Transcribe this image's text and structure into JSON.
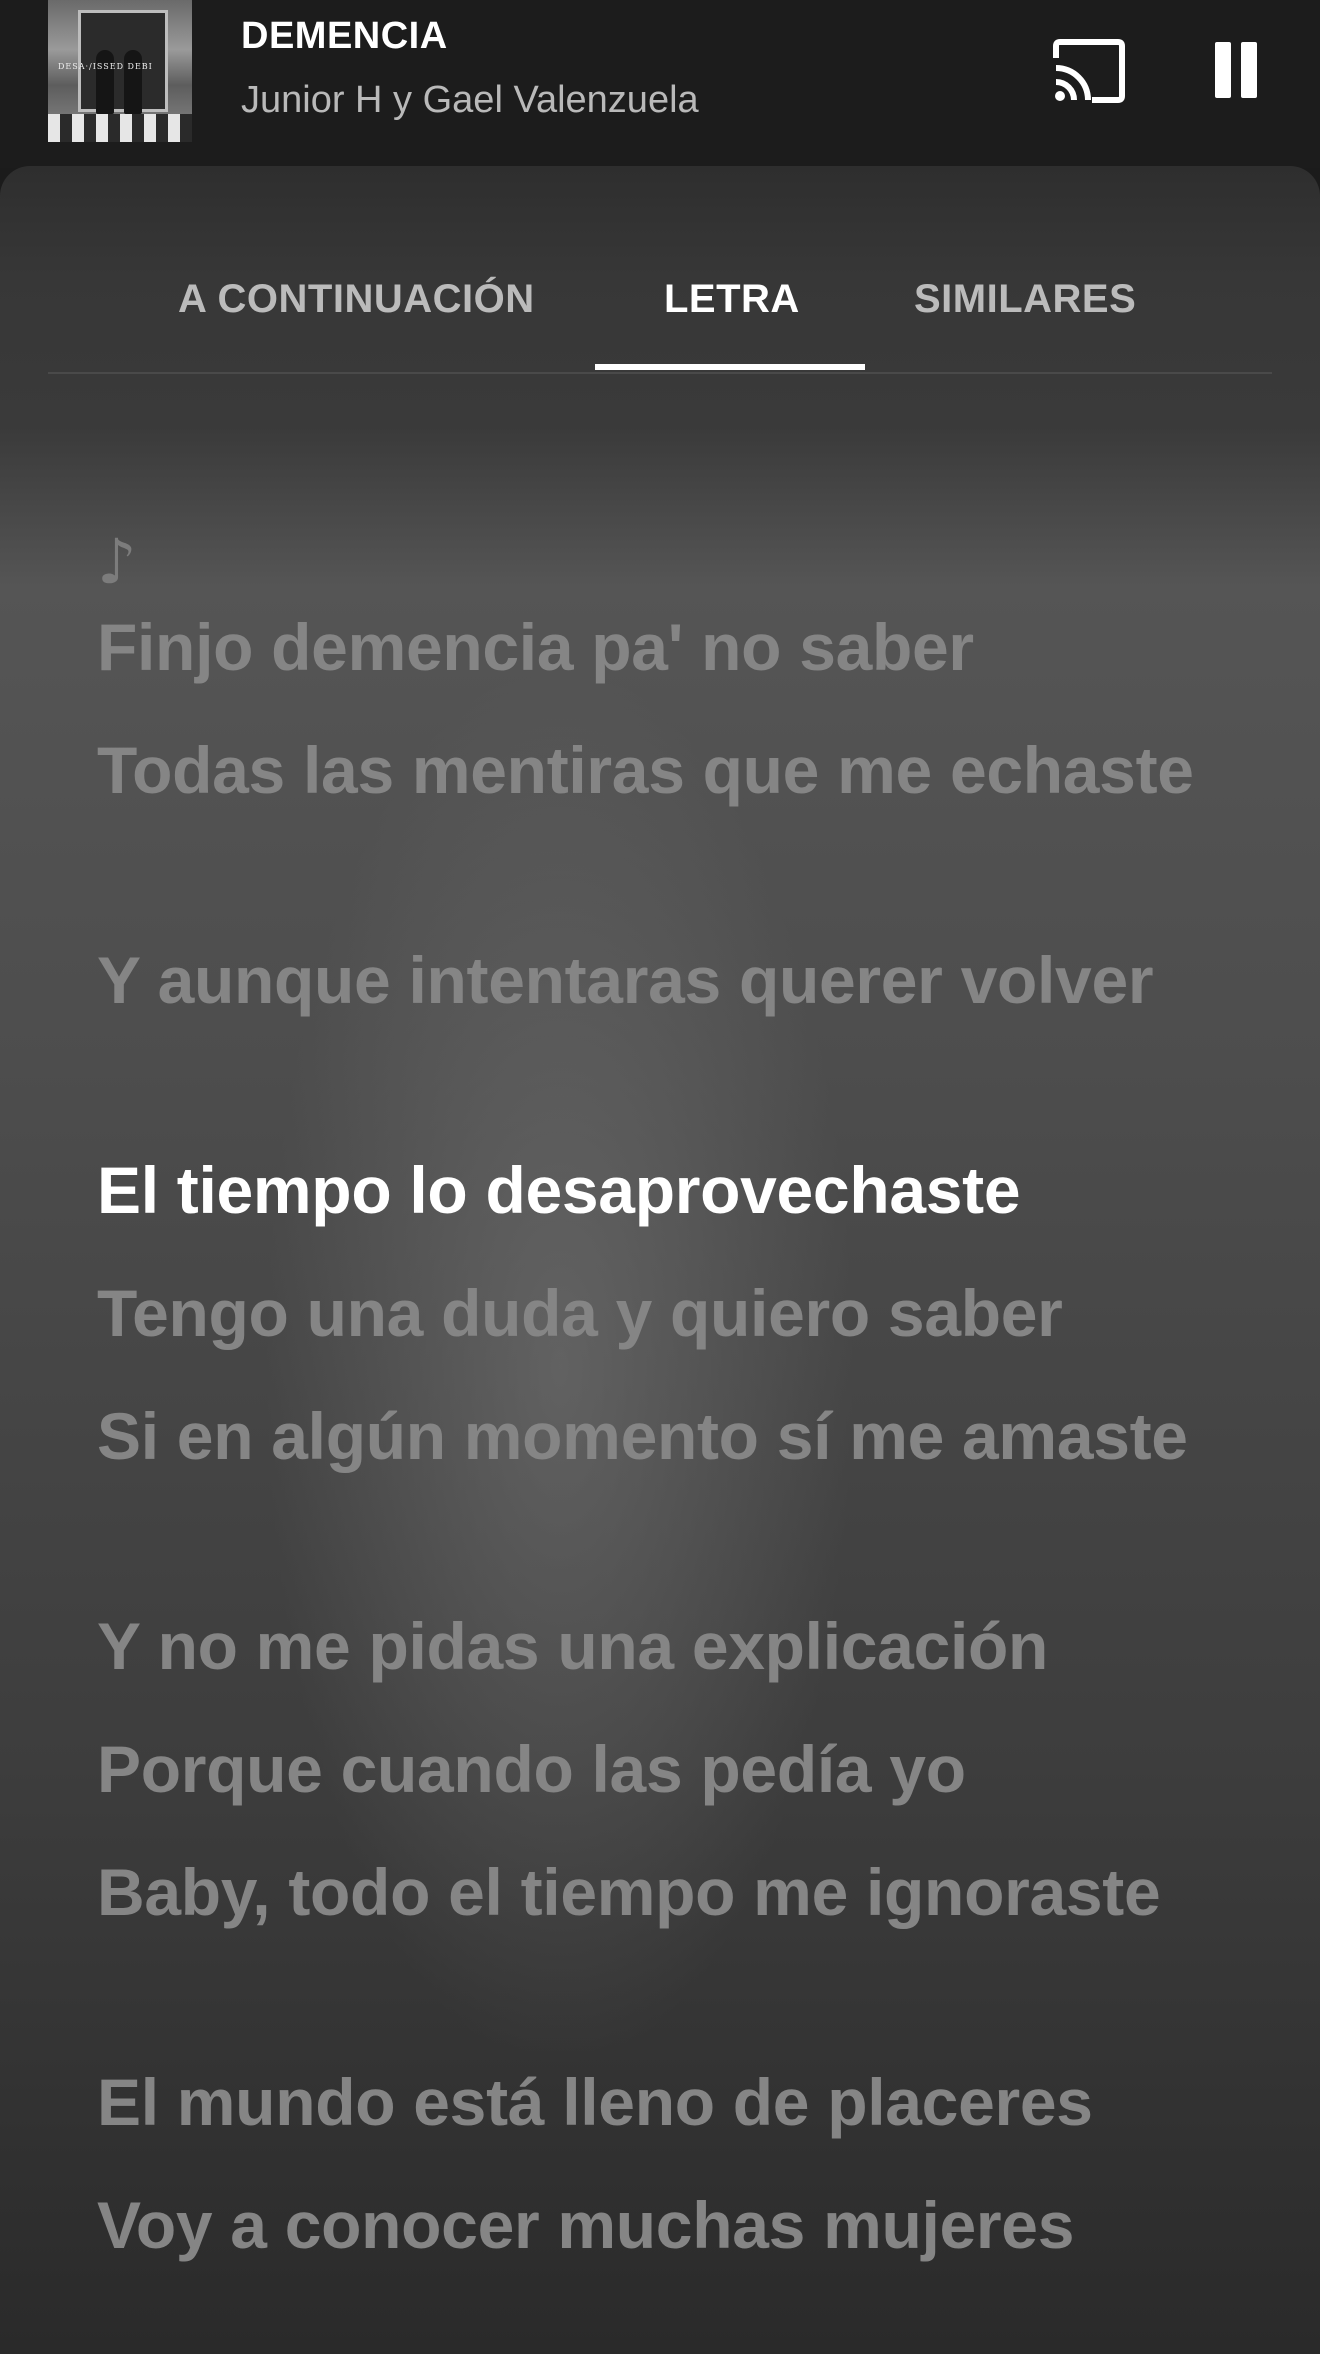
{
  "now_playing": {
    "title": "DEMENCIA",
    "artist": "Junior H y Gael Valenzuela",
    "cover_text": "DESA·/ISSED DEBI"
  },
  "controls": {
    "cast_icon": "cast-icon",
    "pause_icon": "pause-icon"
  },
  "tabs": [
    {
      "label": "A CONTINUACIÓN",
      "active": false
    },
    {
      "label": "LETRA",
      "active": true
    },
    {
      "label": "SIMILARES",
      "active": false
    }
  ],
  "lyrics": {
    "note_glyph": "♪",
    "lines": [
      "Finjo demencia pa' no saber",
      "Todas las mentiras que me echaste",
      "Y aunque intentaras querer volver",
      "El tiempo lo desaprovechaste",
      "Tengo una duda y quiero saber",
      "Si en algún momento sí me amaste",
      "Y no me pidas una explicación",
      "Porque cuando las pedía yo",
      "Baby, todo el tiempo me ignoraste",
      "El mundo está lleno de placeres",
      "Voy a conocer muchas mujeres"
    ],
    "current_line_index": 3
  },
  "colors": {
    "accent": "#ffffff",
    "dim_text": "#858585",
    "secondary_text": "#b9b9b9"
  }
}
